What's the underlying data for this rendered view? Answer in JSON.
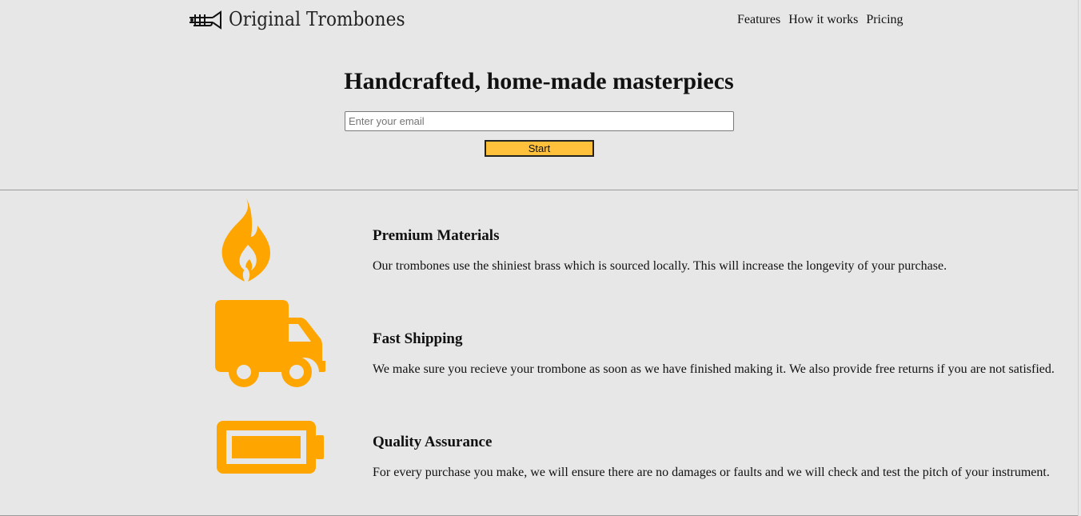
{
  "header": {
    "brand": "Original Trombones",
    "logo_icon": "trombone-logo-icon",
    "nav": [
      "Features",
      "How it works",
      "Pricing"
    ]
  },
  "hero": {
    "title": "Handcrafted, home-made masterpiecs",
    "email_placeholder": "Enter your email",
    "start_label": "Start"
  },
  "features": [
    {
      "icon": "flame-icon",
      "title": "Premium Materials",
      "description": "Our trombones use the shiniest brass which is sourced locally. This will increase the longevity of your purchase."
    },
    {
      "icon": "truck-icon",
      "title": "Fast Shipping",
      "description": "We make sure you recieve your trombone as soon as we have finished making it. We also provide free returns if you are not satisfied."
    },
    {
      "icon": "battery-icon",
      "title": "Quality Assurance",
      "description": "For every purchase you make, we will ensure there are no damages or faults and we will check and test the pitch of your instrument."
    }
  ],
  "colors": {
    "background": "#e6e7e6",
    "accent": "#ffa500",
    "button": "#ffc13b"
  }
}
